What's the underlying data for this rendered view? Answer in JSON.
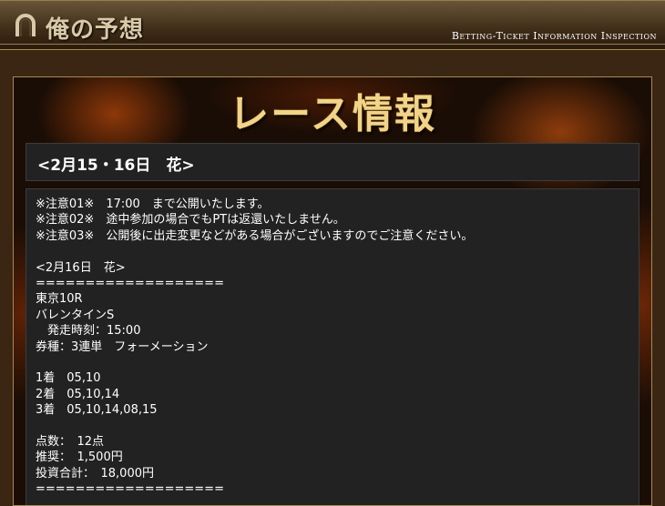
{
  "header": {
    "title": "俺の予想",
    "tagline": "Betting-Ticket Information Inspection",
    "logo_icon": "horseshoe-icon"
  },
  "banner": {
    "title": "レース情報"
  },
  "race_section": {
    "heading": "<2月15・16日　花>",
    "lines": [
      "※注意01※　17:00　まで公開いたします。",
      "※注意02※　途中参加の場合でもPTは返還いたしません。",
      "※注意03※　公開後に出走変更などがある場合がございますのでご注意ください。",
      "",
      "<2月16日　花>",
      "===================",
      "東京10R",
      "バレンタインS",
      "　発走時刻：15:00",
      "券種：3連単　フォーメーション",
      "",
      "1着　05,10",
      "2着　05,10,14",
      "3着　05,10,14,08,15",
      "",
      "点数：　12点",
      "推奨：　1,500円",
      "投資合計：　18,000円",
      "==================="
    ]
  }
}
